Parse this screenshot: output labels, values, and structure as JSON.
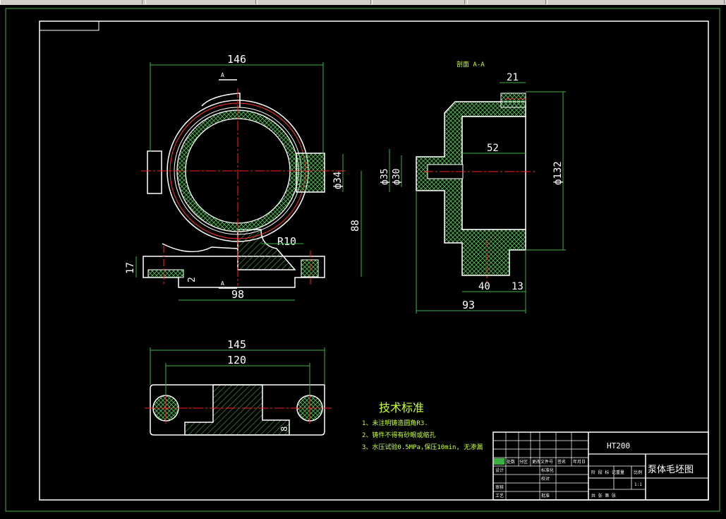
{
  "view_a": {
    "title": "146",
    "dim_34": "ф34",
    "dim_88": "88",
    "dim_17": "17",
    "dim_2": "2",
    "dim_98": "98",
    "radius": "R10",
    "section_mark_top": "A",
    "section_mark_bottom": "A"
  },
  "section_view": {
    "label": "剖面 A-A",
    "dim_21": "21",
    "dim_52": "52",
    "dim_35": "ф35",
    "dim_30": "ф30",
    "dim_132": "ф132",
    "dim_40": "40",
    "dim_13": "13",
    "dim_93": "93"
  },
  "plan_view": {
    "dim_145": "145",
    "dim_120": "120",
    "dim_8": "8"
  },
  "tech": {
    "heading": "技术标准",
    "line1": "1、未注明铸造圆角R3.",
    "line2": "2、铸件不得有砂眼或缩孔",
    "line3": "3、水压试验0.5MPa,保压10min, 无渗漏"
  },
  "title_block": {
    "material": "HT200",
    "drawing_name": "泵体毛坯图",
    "col_1": "处数",
    "col_2": "分区",
    "col_3": "更改文件号",
    "col_4": "签名",
    "col_5": "年月日",
    "row_design": "设计",
    "row_std": "标准化",
    "row_check": "校对",
    "row_review": "审核",
    "row_craft": "工艺",
    "row_approve": "批准",
    "stage": "阶 段 标 记",
    "weight": "重量",
    "scale": "比例",
    "scale_val": "1:1",
    "sheets": "共    张    第    张"
  }
}
